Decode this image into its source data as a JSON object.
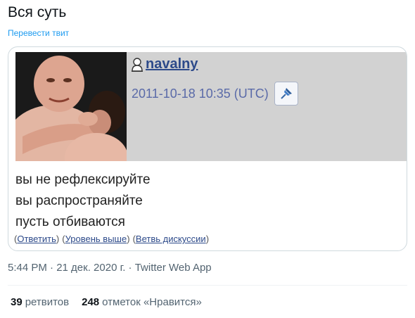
{
  "tweet": {
    "text": "Вся суть",
    "translate_label": "Перевести твит",
    "meta": "5:44 PM · 21 дек. 2020 г. · Twitter Web App"
  },
  "embedded": {
    "username": "navalny",
    "datetime": "2011-10-18 10:35 (UTC)",
    "lines": [
      "вы не рефлексируйте",
      "вы распространяйте",
      "пусть отбиваются"
    ],
    "links": {
      "reply": "Ответить",
      "parent": "Уровень выше",
      "thread": "Ветвь дискуссии"
    },
    "username_color": "#2d4a8a",
    "header_bg": "#d2d2d2"
  },
  "stats": {
    "retweets_count": "39",
    "retweets_label": "ретвитов",
    "likes_count": "248",
    "likes_label": "отметок «Нравится»"
  },
  "icons": {
    "user": "user-head-icon",
    "pin": "pushpin-icon"
  }
}
